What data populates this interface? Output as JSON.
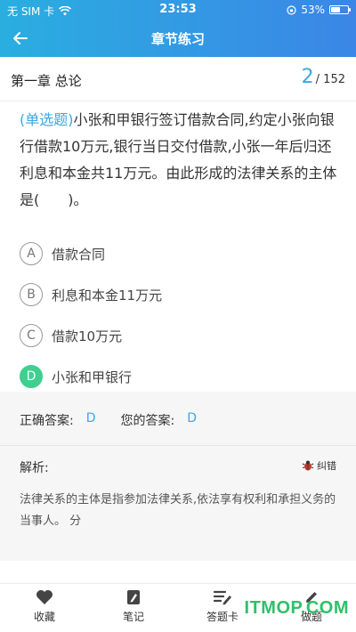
{
  "status_bar": {
    "carrier": "无 SIM 卡",
    "time": "23:53",
    "battery_percent": "53%",
    "battery_level": 0.53
  },
  "header": {
    "title": "章节练习"
  },
  "chapter": {
    "title": "第一章 总论",
    "current": "2",
    "total": "/ 152"
  },
  "question": {
    "type": "(单选题)",
    "text": "小张和甲银行签订借款合同,约定小张向银行借款10万元,银行当日交付借款,小张一年后归还利息和本金共11万元。由此形成的法律关系的主体是(　　)。"
  },
  "options": [
    {
      "letter": "A",
      "text": "借款合同",
      "selected": false
    },
    {
      "letter": "B",
      "text": "利息和本金11万元",
      "selected": false
    },
    {
      "letter": "C",
      "text": "借款10万元",
      "selected": false
    },
    {
      "letter": "D",
      "text": "小张和甲银行",
      "selected": true
    }
  ],
  "answer": {
    "correct_label": "正确答案:",
    "correct_value": "D",
    "yours_label": "您的答案:",
    "yours_value": "D",
    "selected_color": "#3fcf8e",
    "accent_color": "#3aa7e3"
  },
  "analysis": {
    "label": "解析:",
    "correction_label": "纠错",
    "text": "法律关系的主体是指参加法律关系,依法享有权利和承担义务的当事人。 分"
  },
  "tabs": [
    {
      "label": "收藏",
      "icon": "heart-icon"
    },
    {
      "label": "笔记",
      "icon": "note-icon"
    },
    {
      "label": "答题卡",
      "icon": "answer-sheet-icon"
    },
    {
      "label": "做题",
      "icon": "pencil-icon"
    }
  ],
  "watermark": "ITMOP.COM"
}
